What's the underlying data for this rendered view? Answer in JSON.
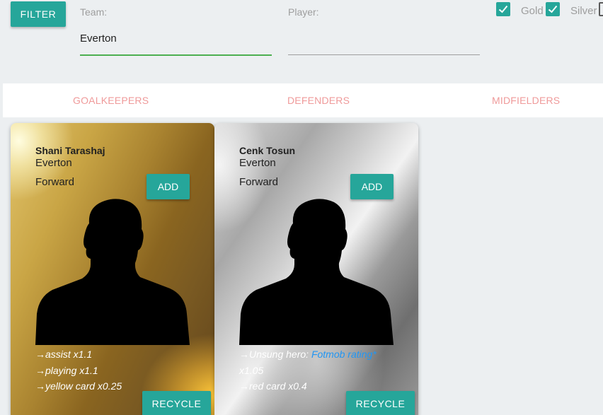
{
  "filter": {
    "button_label": "FILTER",
    "team": {
      "label": "Team:",
      "value": "Everton"
    },
    "player": {
      "label": "Player:",
      "value": ""
    },
    "checkboxes": [
      {
        "label": "Gold",
        "checked": true
      },
      {
        "label": "Silver",
        "checked": true
      },
      {
        "label": "",
        "checked": false
      }
    ]
  },
  "tabs": [
    "GOALKEEPERS",
    "DEFENDERS",
    "MIDFIELDERS"
  ],
  "cards": [
    {
      "tier": "gold",
      "name": "Shani Tarashaj",
      "team": "Everton",
      "position": "Forward",
      "add_label": "ADD",
      "perk_lines": [
        "→assist x1.1",
        "→playing x1.1",
        "→yellow card x0.25"
      ],
      "recycle_label": "RECYCLE"
    },
    {
      "tier": "silver",
      "name": "Cenk Tosun",
      "team": "Everton",
      "position": "Forward",
      "add_label": "ADD",
      "perk_prefix": "→Unsung hero: ",
      "perk_link": "Fotmob rating*",
      "perk_lines": [
        "x1.05",
        "→red card x0.4"
      ],
      "recycle_label": "RECYCLE"
    }
  ],
  "colors": {
    "accent": "#26a69a",
    "tab_text": "#ef9a9a",
    "link": "#2196f3",
    "active_underline": "#4caf50"
  }
}
